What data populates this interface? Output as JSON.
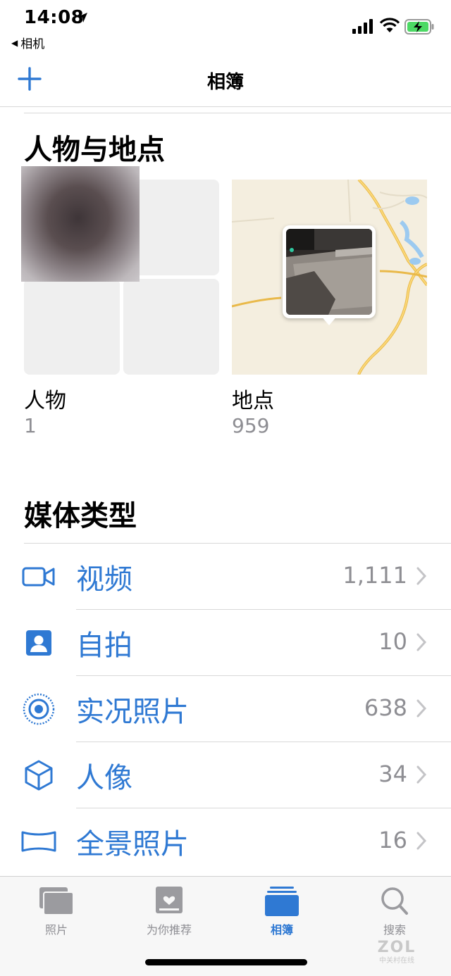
{
  "status_bar": {
    "time": "14:08",
    "back_app": "相机",
    "battery_color": "#4cd964"
  },
  "nav": {
    "title": "相簿",
    "add_icon": "plus-icon"
  },
  "people_places": {
    "section_title": "人物与地点",
    "people": {
      "label": "人物",
      "count": "1"
    },
    "places": {
      "label": "地点",
      "count": "959"
    }
  },
  "media_types": {
    "section_title": "媒体类型",
    "items": [
      {
        "icon": "video-camera-icon",
        "label": "视频",
        "count": "1,111"
      },
      {
        "icon": "selfie-portrait-icon",
        "label": "自拍",
        "count": "10"
      },
      {
        "icon": "live-photo-icon",
        "label": "实况照片",
        "count": "638"
      },
      {
        "icon": "cube-portrait-icon",
        "label": "人像",
        "count": "34"
      },
      {
        "icon": "panorama-icon",
        "label": "全景照片",
        "count": "16"
      }
    ]
  },
  "tab_bar": {
    "tabs": [
      {
        "icon": "photos-stack-icon",
        "label": "照片",
        "active": false
      },
      {
        "icon": "for-you-heart-icon",
        "label": "为你推荐",
        "active": false
      },
      {
        "icon": "albums-icon",
        "label": "相簿",
        "active": true
      },
      {
        "icon": "search-icon",
        "label": "搜索",
        "active": false
      }
    ]
  },
  "watermark": {
    "logo": "ZOL",
    "caption": "中关村在线"
  },
  "colors": {
    "accent": "#2f79d3",
    "secondary_text": "#8e8e93",
    "separator": "#d8d8d8"
  }
}
